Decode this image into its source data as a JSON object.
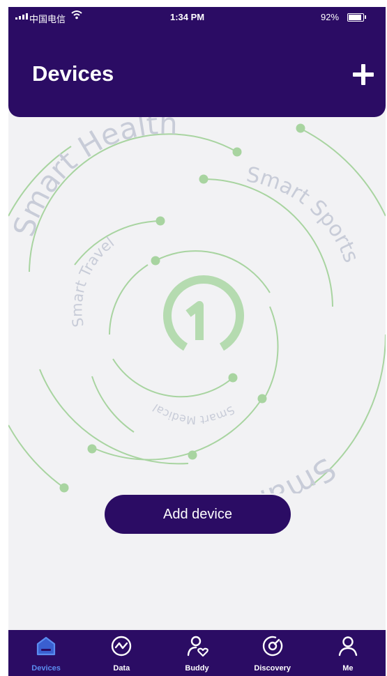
{
  "status_bar": {
    "carrier": "中国电信",
    "time": "1:34 PM",
    "battery": "92%",
    "battery_level": 0.92
  },
  "header": {
    "title": "Devices",
    "add_icon": "plus-icon"
  },
  "illustration": {
    "labels": [
      "Smart Health",
      "Smart Sports",
      "Smart Travel",
      "Smart Medical",
      "Smart"
    ],
    "logo_icon": "one-logo-icon"
  },
  "add_device_label": "Add device",
  "tabs": [
    {
      "label": "Devices",
      "icon": "home-icon",
      "active": true
    },
    {
      "label": "Data",
      "icon": "chart-icon",
      "active": false
    },
    {
      "label": "Buddy",
      "icon": "buddy-icon",
      "active": false
    },
    {
      "label": "Discovery",
      "icon": "compass-icon",
      "active": false
    },
    {
      "label": "Me",
      "icon": "person-icon",
      "active": false
    }
  ],
  "colors": {
    "primary": "#2b0c64",
    "background": "#f2f2f4",
    "accent_green": "#a8d4a0",
    "label_gray": "#c8ccd8",
    "active_tab": "#5b8df0"
  }
}
